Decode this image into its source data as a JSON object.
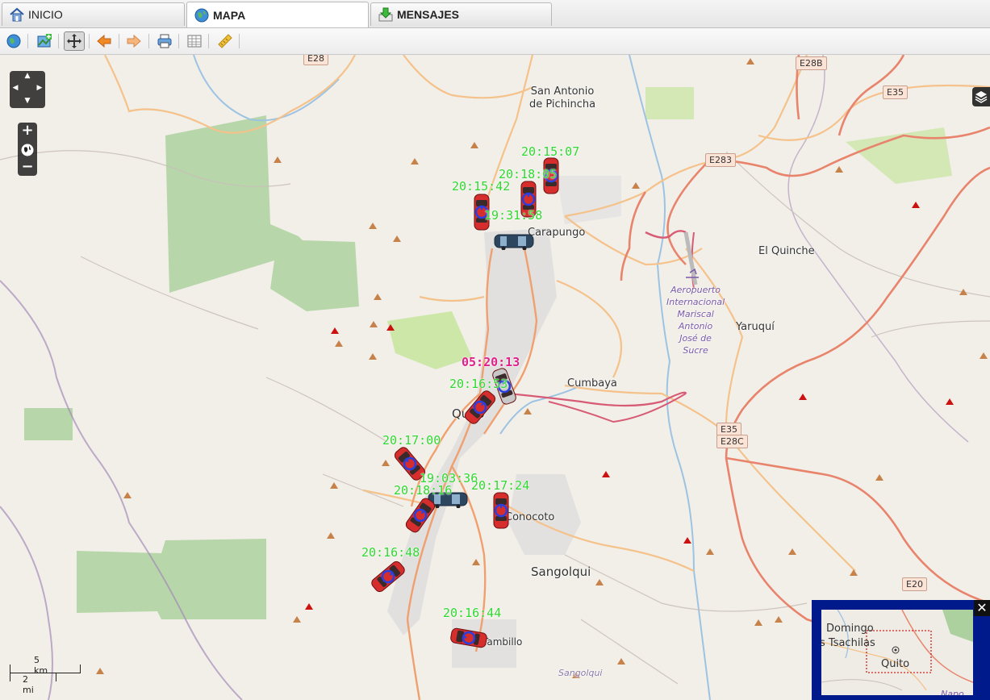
{
  "tabs": [
    {
      "label": "INICIO",
      "icon": "home-icon",
      "active": false
    },
    {
      "label": "MAPA",
      "icon": "globe-icon",
      "active": true
    },
    {
      "label": "MENSAJES",
      "icon": "inbox-download-icon",
      "active": false
    }
  ],
  "toolbar": {
    "buttons": [
      "globe-icon",
      "add-map-layer-icon",
      "pan-icon",
      "back-arrow-icon",
      "forward-arrow-icon",
      "print-icon",
      "grid-table-icon",
      "ruler-icon"
    ],
    "selected": "pan-icon"
  },
  "map": {
    "places": [
      {
        "name": "San Antonio\nde Pichincha"
      },
      {
        "name": "Carapungo"
      },
      {
        "name": "El Quinche"
      },
      {
        "name": "Yaruquí"
      },
      {
        "name": "Cumbaya"
      },
      {
        "name": "Quito"
      },
      {
        "name": "Conocoto"
      },
      {
        "name": "Sangolqui"
      },
      {
        "name": "Sangolqui"
      },
      {
        "name": "Tambillo"
      },
      {
        "name": "Aeropuerto\nInternacional\nMariscal\nAntonio\nJosé de\nSucre"
      }
    ],
    "road_shields": [
      "E28",
      "E28B",
      "E35",
      "E283",
      "E35",
      "E28C",
      "E20"
    ],
    "vehicles": [
      {
        "time": "20:15:07",
        "type": "car",
        "status": "normal"
      },
      {
        "time": "20:18:05",
        "type": "car",
        "status": "normal"
      },
      {
        "time": "20:15:42",
        "type": "car",
        "status": "normal"
      },
      {
        "time": "19:31:58",
        "type": "bus",
        "status": "normal"
      },
      {
        "time": "05:20:13",
        "type": "car",
        "status": "alert"
      },
      {
        "time": "20:16:53",
        "type": "car",
        "status": "normal"
      },
      {
        "time": "20:17:00",
        "type": "car",
        "status": "normal"
      },
      {
        "time": "19:03:36",
        "type": "bus",
        "status": "normal"
      },
      {
        "time": "20:18:16",
        "type": "car",
        "status": "normal"
      },
      {
        "time": "20:17:24",
        "type": "car",
        "status": "normal"
      },
      {
        "time": "20:16:48",
        "type": "car",
        "status": "normal"
      },
      {
        "time": "20:16:44",
        "type": "car",
        "status": "normal"
      }
    ],
    "scale": {
      "km": "5 km",
      "mi": "2 mi"
    },
    "overview": {
      "labels": [
        "Domingo",
        "s Tsachilas",
        "Quito",
        "Napo"
      ]
    }
  },
  "colors": {
    "label_time": "#2fd82f",
    "label_alert": "#e0218a",
    "overview_frame": "#001a8c",
    "car": "#d62d2d",
    "bus": "#2d4660"
  }
}
